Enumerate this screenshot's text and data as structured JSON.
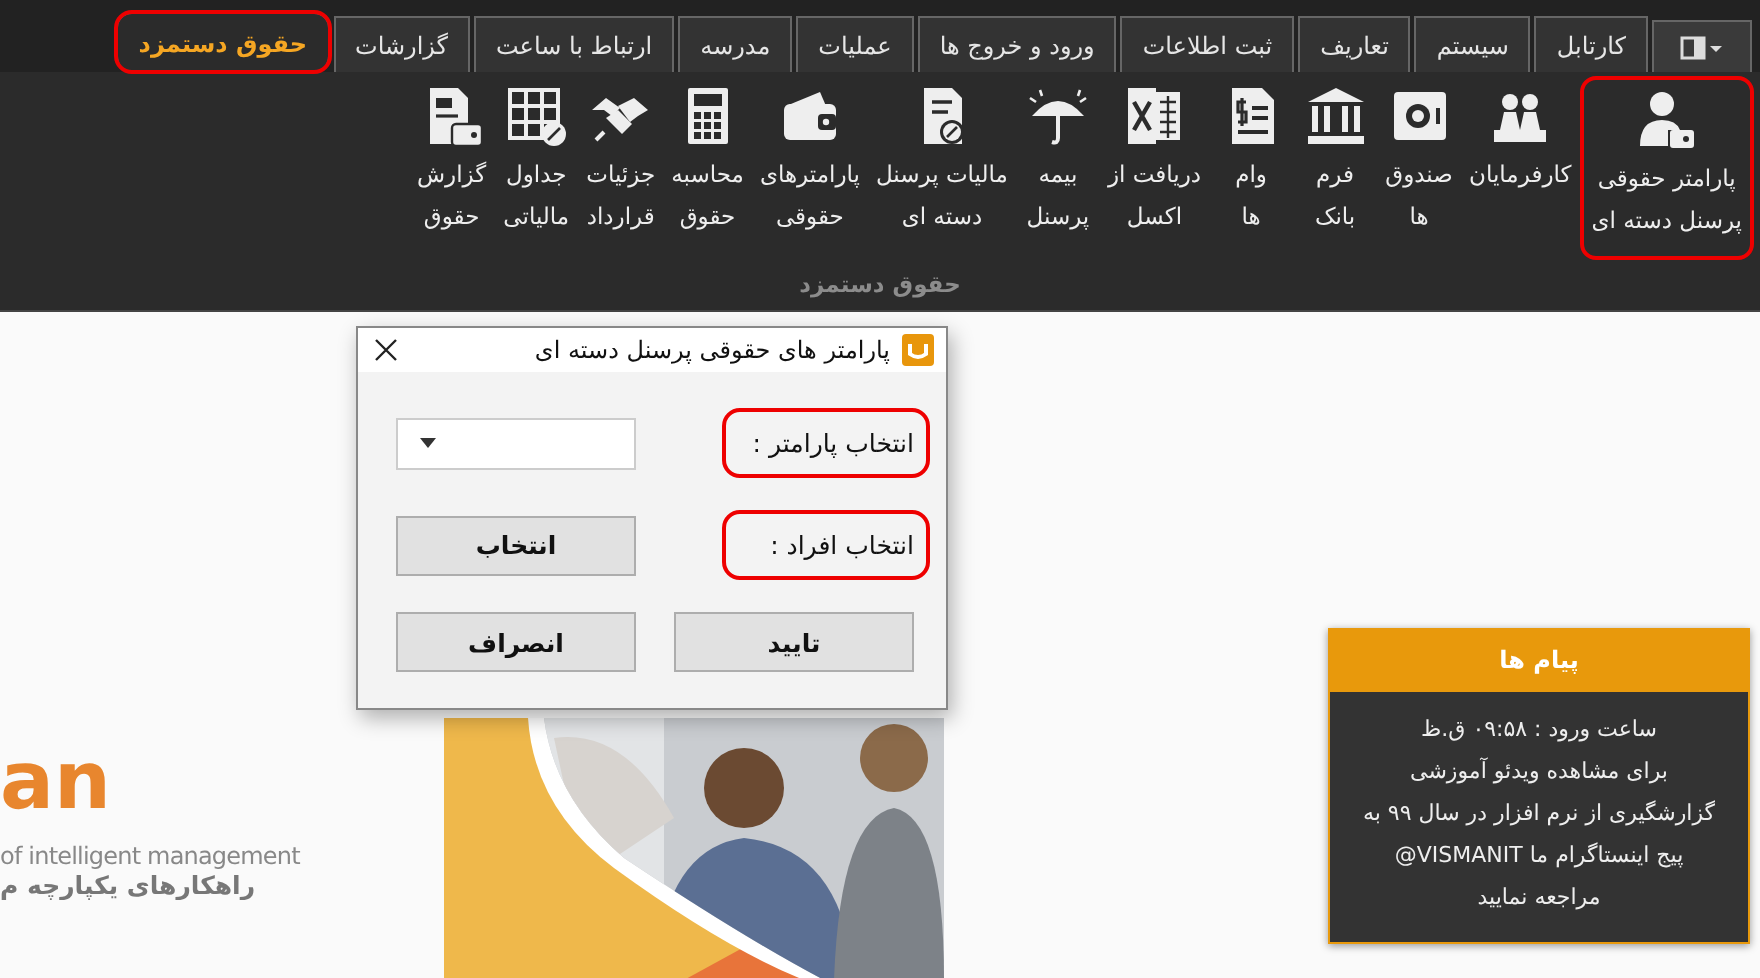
{
  "tabs": [
    {
      "label": "کارتابل",
      "selected": false,
      "highlighted": false
    },
    {
      "label": "سیستم",
      "selected": false,
      "highlighted": false
    },
    {
      "label": "تعاریف",
      "selected": false,
      "highlighted": false
    },
    {
      "label": "ثبت اطلاعات",
      "selected": false,
      "highlighted": false
    },
    {
      "label": "ورود و خروج ها",
      "selected": false,
      "highlighted": false
    },
    {
      "label": "عملیات",
      "selected": false,
      "highlighted": false
    },
    {
      "label": "مدرسه",
      "selected": false,
      "highlighted": false
    },
    {
      "label": "ارتباط با ساعت",
      "selected": false,
      "highlighted": false
    },
    {
      "label": "گزارشات",
      "selected": false,
      "highlighted": false
    },
    {
      "label": "حقوق دستمزد",
      "selected": true,
      "highlighted": true
    }
  ],
  "ribbon": {
    "group_label": "حقوق دستمزد",
    "buttons": [
      {
        "lines": [
          "پارامتر حقوقی",
          "پرسنل دسته ای"
        ],
        "highlighted": true
      },
      {
        "lines": [
          "کارفرمایان"
        ],
        "highlighted": false
      },
      {
        "lines": [
          "صندوق",
          "ها"
        ],
        "highlighted": false
      },
      {
        "lines": [
          "فرم",
          "بانک"
        ],
        "highlighted": false
      },
      {
        "lines": [
          "وام",
          "ها"
        ],
        "highlighted": false
      },
      {
        "lines": [
          "دریافت از",
          "اکسل"
        ],
        "highlighted": false
      },
      {
        "lines": [
          "بیمه",
          "پرسنل"
        ],
        "highlighted": false
      },
      {
        "lines": [
          "مالیات پرسنل",
          "دسته ای"
        ],
        "highlighted": false
      },
      {
        "lines": [
          "پارامترهای",
          "حقوقی"
        ],
        "highlighted": false
      },
      {
        "lines": [
          "محاسبه",
          "حقوق"
        ],
        "highlighted": false
      },
      {
        "lines": [
          "جزئیات",
          "قرارداد"
        ],
        "highlighted": false
      },
      {
        "lines": [
          "جداول",
          "مالیاتی"
        ],
        "highlighted": false
      },
      {
        "lines": [
          "گزارش",
          "حقوق"
        ],
        "highlighted": false
      }
    ]
  },
  "background": {
    "logo_mark": "an",
    "logo_tagline": "of intelligent management",
    "logo_subtitle": "راهکارهای یکپارچه م"
  },
  "dialog": {
    "title": "پارامتر های حقوقی پرسنل دسته ای",
    "fields": [
      {
        "kind": "dropdown",
        "label": "انتخاب پارامتر :",
        "highlighted": true
      },
      {
        "kind": "button",
        "label": "انتخاب افراد :",
        "button": "انتخاب",
        "highlighted": true
      }
    ],
    "buttons": [
      "تایید",
      "انصراف"
    ]
  },
  "messages": {
    "title": "پیام ها",
    "lines": [
      "ساعت ورود : ۰۹:۵۸ ق.ظ",
      "برای مشاهده ویدئو آموزشی",
      "گزارشگیری از نرم افزار در سال ۹۹ به",
      "پیج اینستاگرام ما VISMANIT@",
      "مراجعه نمایید"
    ]
  }
}
